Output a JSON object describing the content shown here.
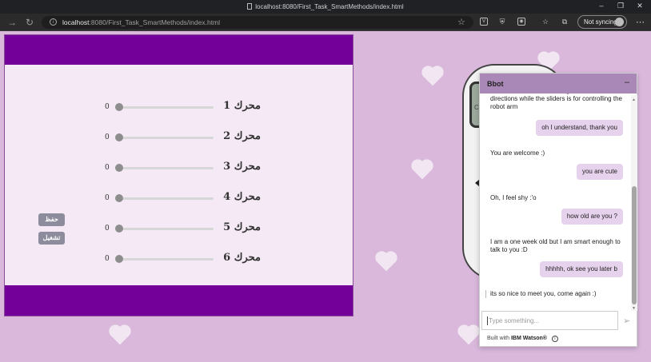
{
  "browser": {
    "window_title": "localhost:8080/First_Task_SmartMethods/index.html",
    "url_host": "localhost",
    "url_rest": ":8080/First_Task_SmartMethods/index.html",
    "sync_label": "Not syncing",
    "icons": [
      "back-arrow-icon",
      "refresh-icon",
      "info-icon",
      "favorite-star-icon",
      "extension-v-icon",
      "shield-icon",
      "camera-icon",
      "favorites-icon",
      "collections-icon",
      "profile-avatar-icon",
      "more-icon"
    ]
  },
  "panel": {
    "motors": [
      {
        "label": "محرك 1",
        "value": "0",
        "level": 0
      },
      {
        "label": "محرك 2",
        "value": "0",
        "level": 0
      },
      {
        "label": "محرك 3",
        "value": "0",
        "level": 0
      },
      {
        "label": "محرك 4",
        "value": "0",
        "level": 0
      },
      {
        "label": "محرك 5",
        "value": "0",
        "level": 0
      },
      {
        "label": "محرك 6",
        "value": "0",
        "level": 0
      }
    ],
    "save_label": "حفظ",
    "run_label": "تشغيل",
    "colors": {
      "header": "#730098",
      "body": "#f4e9f5"
    }
  },
  "remote": {
    "screen_text": "Co"
  },
  "chat": {
    "title": "Bbot",
    "minimize_label": "–",
    "messages": [
      {
        "from": "bot",
        "text": "The remote is for controlling the robot directions while the sliders is for controlling the robot arm"
      },
      {
        "from": "user",
        "text": "oh I understand, thank you"
      },
      {
        "from": "bot",
        "text": "You are welcome :)"
      },
      {
        "from": "user",
        "text": "you are cute"
      },
      {
        "from": "bot",
        "text": "Oh, I feel shy :'o"
      },
      {
        "from": "user",
        "text": "how old are you ?"
      },
      {
        "from": "bot",
        "text": "I am a one week old but I am smart enough to talk to you :D"
      },
      {
        "from": "user",
        "text": "hhhhh, ok see you later b"
      },
      {
        "from": "bot",
        "text": "its so nice to meet you, come again :)"
      }
    ],
    "input_placeholder": "Type something...",
    "footer_prefix": "Built with",
    "footer_brand": "IBM Watson®",
    "colors": {
      "header": "#a988b8",
      "user_bubble": "#e6d2ec"
    }
  }
}
